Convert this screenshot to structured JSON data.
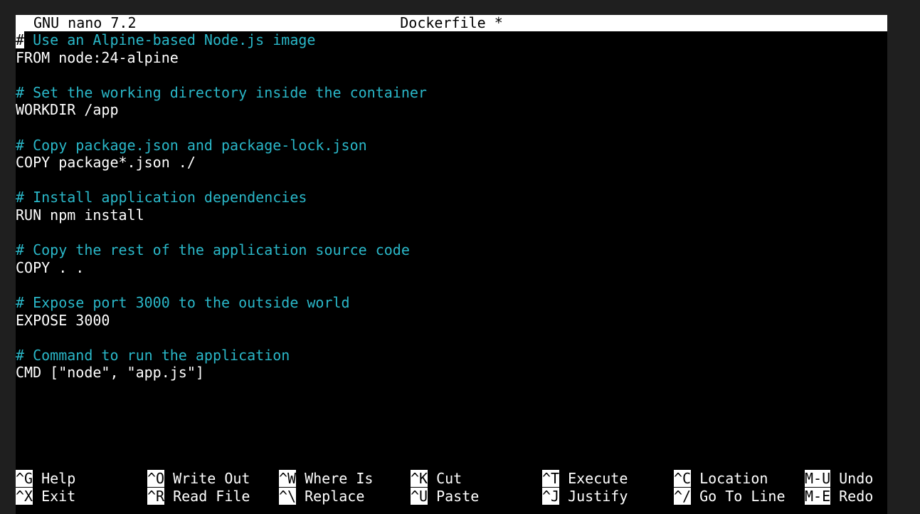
{
  "app": {
    "name": "GNU nano 7.2",
    "filename": "Dockerfile *"
  },
  "editor": {
    "lines": [
      {
        "text": "# Use an Alpine-based Node.js image",
        "kind": "comment"
      },
      {
        "text": "FROM node:24-alpine",
        "kind": "code"
      },
      {
        "text": "",
        "kind": "blank"
      },
      {
        "text": "# Set the working directory inside the container",
        "kind": "comment"
      },
      {
        "text": "WORKDIR /app",
        "kind": "code"
      },
      {
        "text": "",
        "kind": "blank"
      },
      {
        "text": "# Copy package.json and package-lock.json",
        "kind": "comment"
      },
      {
        "text": "COPY package*.json ./",
        "kind": "code"
      },
      {
        "text": "",
        "kind": "blank"
      },
      {
        "text": "# Install application dependencies",
        "kind": "comment"
      },
      {
        "text": "RUN npm install",
        "kind": "code"
      },
      {
        "text": "",
        "kind": "blank"
      },
      {
        "text": "# Copy the rest of the application source code",
        "kind": "comment"
      },
      {
        "text": "COPY . .",
        "kind": "code"
      },
      {
        "text": "",
        "kind": "blank"
      },
      {
        "text": "# Expose port 3000 to the outside world",
        "kind": "comment"
      },
      {
        "text": "EXPOSE 3000",
        "kind": "code"
      },
      {
        "text": "",
        "kind": "blank"
      },
      {
        "text": "# Command to run the application",
        "kind": "comment"
      },
      {
        "text": "CMD [\"node\", \"app.js\"]",
        "kind": "code"
      }
    ]
  },
  "shortcuts": {
    "row1": [
      {
        "key": "^G",
        "label": "Help"
      },
      {
        "key": "^O",
        "label": "Write Out"
      },
      {
        "key": "^W",
        "label": "Where Is"
      },
      {
        "key": "^K",
        "label": "Cut"
      },
      {
        "key": "^T",
        "label": "Execute"
      },
      {
        "key": "^C",
        "label": "Location"
      },
      {
        "key": "M-U",
        "label": "Undo"
      }
    ],
    "row2": [
      {
        "key": "^X",
        "label": "Exit"
      },
      {
        "key": "^R",
        "label": "Read File"
      },
      {
        "key": "^\\",
        "label": "Replace"
      },
      {
        "key": "^U",
        "label": "Paste"
      },
      {
        "key": "^J",
        "label": "Justify"
      },
      {
        "key": "^/",
        "label": "Go To Line"
      },
      {
        "key": "M-E",
        "label": "Redo"
      }
    ]
  },
  "colors": {
    "background": "#000000",
    "comment": "#2ab7c8",
    "code": "#ffffff",
    "titlebar": "#ffffff",
    "frame": "#1f1f1f"
  }
}
